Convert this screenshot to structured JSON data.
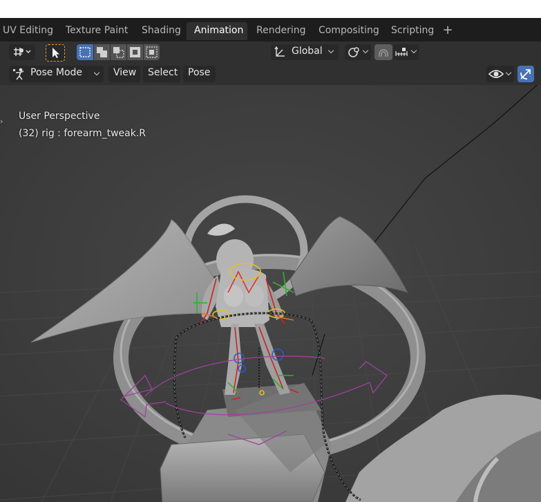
{
  "workspace_tabs": [
    "UV Editing",
    "Texture Paint",
    "Shading",
    "Animation",
    "Rendering",
    "Compositing",
    "Scripting"
  ],
  "active_tab": "Animation",
  "add_tab_label": "+",
  "toolbar": {
    "transform_orientation": "Global"
  },
  "header": {
    "mode": "Pose Mode",
    "menus": [
      "View",
      "Select",
      "Pose"
    ]
  },
  "viewport": {
    "view_name": "User Perspective",
    "active_object": "(32) rig : forearm_tweak.R"
  },
  "colors": {
    "tab_bar": "#1d1d1d",
    "header": "#303030",
    "viewport_bg": "#3d3d3d",
    "accent_blue": "#4772b3",
    "snap_orange": "#e5a13a"
  },
  "icons": [
    "transform-pivot-icon",
    "select-tool-icon",
    "select-mode-icons",
    "orientation-icon",
    "pivot-icon",
    "snap-icon",
    "proportional-icon",
    "pose-mode-icon",
    "visibility-icon",
    "gizmo-icon"
  ]
}
